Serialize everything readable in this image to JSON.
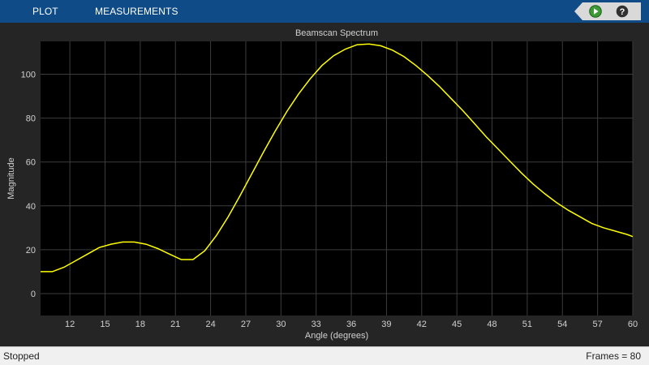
{
  "toolstrip": {
    "tabs": [
      {
        "label": "PLOT"
      },
      {
        "label": "MEASUREMENTS"
      }
    ],
    "run_icon": "play-icon",
    "help_icon": "question-icon",
    "background": "#0f4b87"
  },
  "chart_data": {
    "type": "line",
    "title": "Beamscan Spectrum",
    "xlabel": "Angle (degrees)",
    "ylabel": "Magnitude",
    "xlim": [
      9.5,
      60
    ],
    "ylim": [
      -10,
      115
    ],
    "xticks": [
      12,
      15,
      18,
      21,
      24,
      27,
      30,
      33,
      36,
      39,
      42,
      45,
      48,
      51,
      54,
      57,
      60
    ],
    "yticks": [
      0,
      20,
      40,
      60,
      80,
      100
    ],
    "grid": true,
    "line_color": "#ffff00",
    "background": "#000000",
    "series": [
      {
        "x": [
          9.5,
          10.5,
          11.5,
          12.5,
          13.5,
          14.5,
          15.5,
          16.5,
          17.5,
          18.5,
          19.5,
          20.5,
          21.5,
          22.5,
          23.5,
          24.5,
          25.5,
          26.5,
          27.5,
          28.5,
          29.5,
          30.5,
          31.5,
          32.5,
          33.5,
          34.5,
          35.5,
          36.5,
          37.5,
          38.5,
          39.5,
          40.5,
          41.5,
          42.5,
          43.5,
          44.5,
          45.5,
          46.5,
          47.5,
          48.5,
          49.5,
          50.5,
          51.5,
          52.5,
          53.5,
          54.5,
          55.5,
          56.5,
          57.5,
          58.5,
          59.5,
          60
        ],
        "values": [
          10,
          10,
          12,
          15,
          18,
          21,
          22.5,
          23.5,
          23.5,
          22.5,
          20.5,
          18,
          15.5,
          15.5,
          19.5,
          26.5,
          35,
          44.5,
          54.5,
          64.5,
          74,
          83,
          91,
          98,
          104,
          108.5,
          111.5,
          113.5,
          113.8,
          113,
          111,
          108,
          104,
          99.5,
          94.5,
          89,
          83.5,
          77.5,
          71.5,
          66,
          60.5,
          55,
          50,
          45.5,
          41.5,
          38,
          35,
          32,
          30,
          28.5,
          27,
          26
        ]
      }
    ]
  },
  "status": {
    "state": "Stopped",
    "frames": "Frames = 80"
  }
}
